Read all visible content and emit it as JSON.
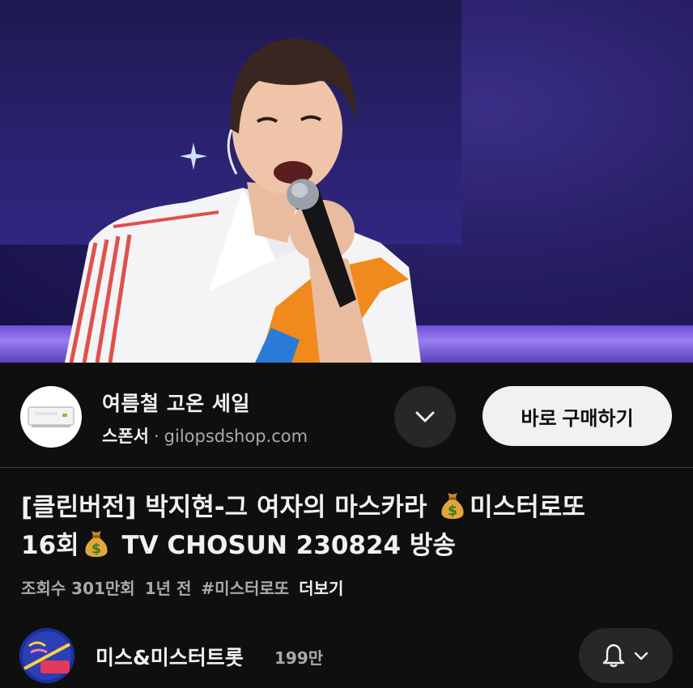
{
  "ad": {
    "title": "여름철 고온 세일",
    "sponsor_label": "스폰서",
    "separator": "·",
    "domain": "gilopsdshop.com",
    "cta_label": "바로 구매하기"
  },
  "video": {
    "title_part1": "[클린버전] 박지현-그 여자의 마스카라 ",
    "title_part2": "미스터로또",
    "title_part3": "16회",
    "title_part4": " TV CHOSUN 230824 방송",
    "views": "조회수 301만회",
    "age": "1년 전",
    "hashtag": "#미스터로또",
    "more_label": "더보기"
  },
  "channel": {
    "name": "미스&미스터트롯",
    "subscribers": "199만"
  },
  "icons": {
    "expand": "chevron-down-icon",
    "money": "money-bag-icon",
    "bell": "bell-icon",
    "bell_menu": "chevron-down-icon"
  },
  "colors": {
    "background": "#0f0f0f",
    "button_dark": "#272727",
    "button_light": "#f1f1f1",
    "secondary_text": "#aaaaaa"
  }
}
